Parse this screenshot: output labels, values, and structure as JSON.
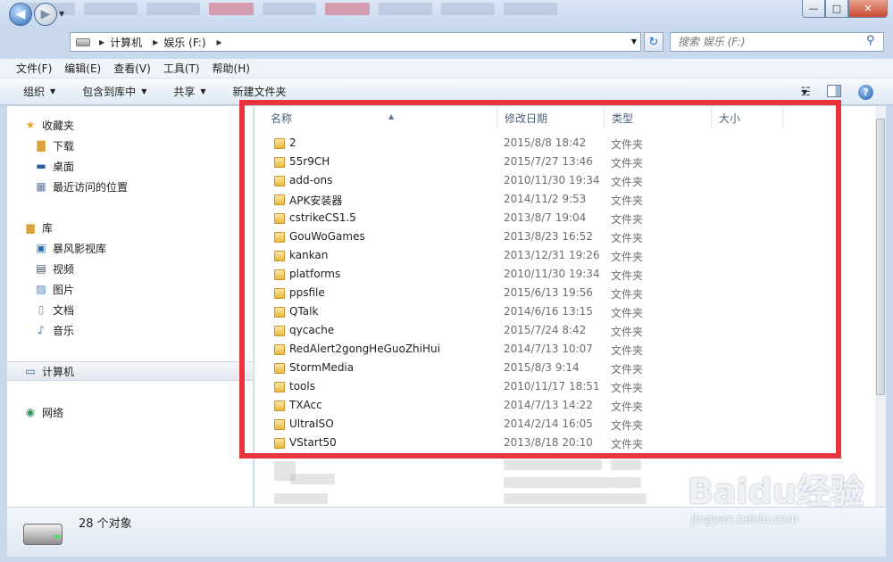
{
  "window": {
    "controls": {
      "minimize": "—",
      "maximize": "□",
      "close": "✕"
    }
  },
  "address": {
    "crumbs": [
      "计算机",
      "娱乐 (F:)"
    ],
    "search_placeholder": "搜索 娱乐 (F:)"
  },
  "menu": [
    "文件(F)",
    "编辑(E)",
    "查看(V)",
    "工具(T)",
    "帮助(H)"
  ],
  "toolbar": {
    "organize": "组织",
    "include_library": "包含到库中",
    "share": "共享",
    "new_folder": "新建文件夹"
  },
  "nav": {
    "favorites": "收藏夹",
    "downloads": "下载",
    "desktop": "桌面",
    "recent": "最近访问的位置",
    "libraries": "库",
    "storm_video": "暴风影视库",
    "videos": "视频",
    "pictures": "图片",
    "documents": "文档",
    "music": "音乐",
    "computer": "计算机",
    "network": "网络"
  },
  "columns": {
    "name": "名称",
    "modified": "修改日期",
    "type": "类型",
    "size": "大小"
  },
  "files": [
    {
      "name": "2",
      "date": "2015/8/8 18:42",
      "type": "文件夹"
    },
    {
      "name": "55r9CH",
      "date": "2015/7/27 13:46",
      "type": "文件夹"
    },
    {
      "name": "add-ons",
      "date": "2010/11/30 19:34",
      "type": "文件夹"
    },
    {
      "name": "APK安装器",
      "date": "2014/11/2 9:53",
      "type": "文件夹"
    },
    {
      "name": "cstrikeCS1.5",
      "date": "2013/8/7 19:04",
      "type": "文件夹"
    },
    {
      "name": "GouWoGames",
      "date": "2013/8/23 16:52",
      "type": "文件夹"
    },
    {
      "name": "kankan",
      "date": "2013/12/31 19:26",
      "type": "文件夹"
    },
    {
      "name": "platforms",
      "date": "2010/11/30 19:34",
      "type": "文件夹"
    },
    {
      "name": "ppsfile",
      "date": "2015/6/13 19:56",
      "type": "文件夹"
    },
    {
      "name": "QTalk",
      "date": "2014/6/16 13:15",
      "type": "文件夹"
    },
    {
      "name": "qycache",
      "date": "2015/7/24 8:42",
      "type": "文件夹"
    },
    {
      "name": "RedAlert2gongHeGuoZhiHui",
      "date": "2014/7/13 10:07",
      "type": "文件夹"
    },
    {
      "name": "StormMedia",
      "date": "2015/8/3 9:14",
      "type": "文件夹"
    },
    {
      "name": "tools",
      "date": "2010/11/17 18:51",
      "type": "文件夹"
    },
    {
      "name": "TXAcc",
      "date": "2014/7/13 14:22",
      "type": "文件夹"
    },
    {
      "name": "UltraISO",
      "date": "2014/2/14 16:05",
      "type": "文件夹"
    },
    {
      "name": "VStart50",
      "date": "2013/8/18 20:10",
      "type": "文件夹"
    }
  ],
  "status": {
    "count": "28 个对象"
  },
  "watermark": {
    "main": "Baidu经验",
    "sub": "jingyan.baidu.com"
  },
  "colors": {
    "highlight": "#e8343c",
    "folder": "#e8b93f"
  }
}
